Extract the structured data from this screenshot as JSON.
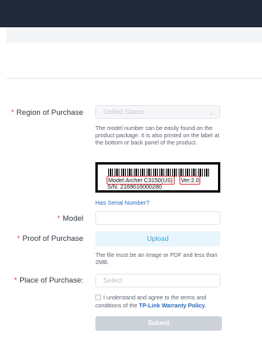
{
  "form": {
    "region": {
      "label": "Region of Purchase",
      "value": "United States"
    },
    "model_hint": "The model number can be easily found on the product package. It is also printed on the label at the bottom or back panel of the product.",
    "sample_label": {
      "model_prefix": "Model:Archer C3150",
      "model_suffix": "(US)",
      "version": "Ver:2.0",
      "serial": "S/N: 2169016000280"
    },
    "serial_link": "Has Serial Number?",
    "model": {
      "label": "Model",
      "value": ""
    },
    "proof": {
      "label": "Proof of Purchase",
      "button": "Upload",
      "hint": "The file must be an image or PDF and less than 2MB."
    },
    "place": {
      "label": "Place of Purchase:",
      "placeholder": "Select"
    },
    "agreement": {
      "text": "I understand and agree to the terms and conditions of the ",
      "policy_link": "TP-Link Warranty Policy",
      "end": "."
    },
    "submit_label": "Submit",
    "required_mark": "*"
  },
  "colors": {
    "header_bg": "#212839",
    "required": "#e2424b",
    "link": "#2b6cc4",
    "upload_text": "#3aa3d8",
    "upload_bg": "#e8f5fc",
    "submit_bg": "#cdd1d8"
  }
}
